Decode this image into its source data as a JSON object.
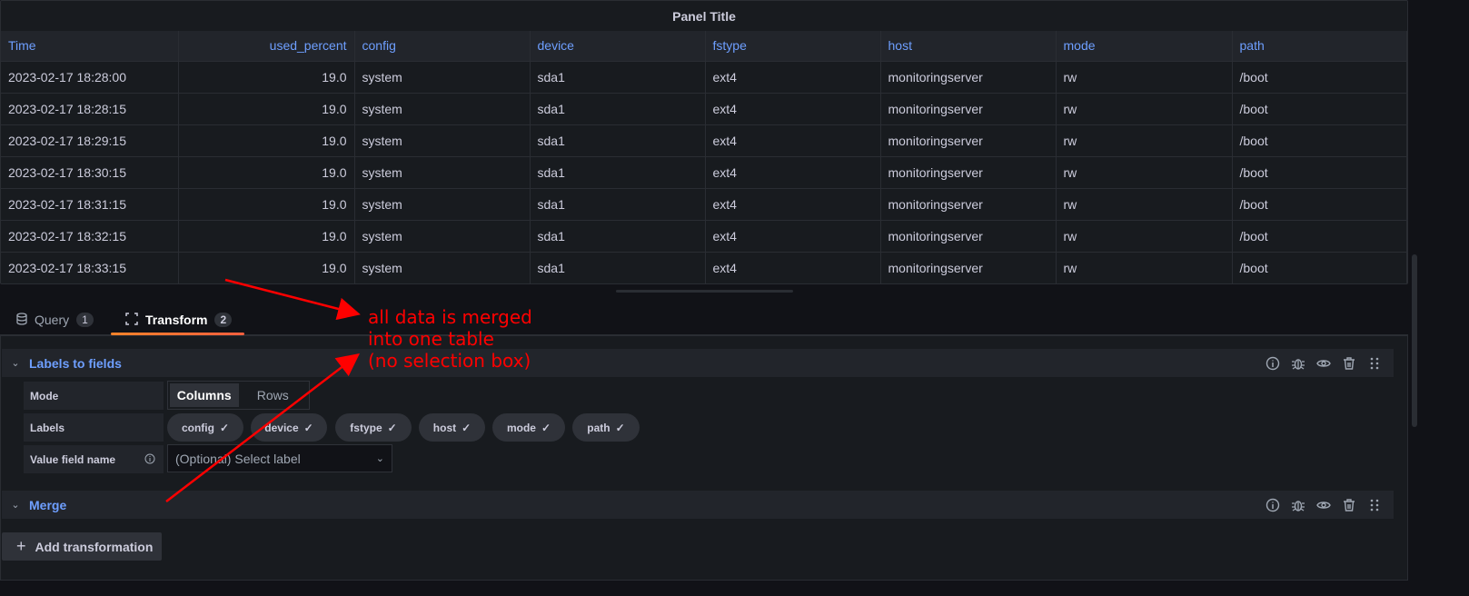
{
  "panel": {
    "title": "Panel Title",
    "columns": [
      "Time",
      "used_percent",
      "config",
      "device",
      "fstype",
      "host",
      "mode",
      "path"
    ],
    "rows": [
      [
        "2023-02-17 18:28:00",
        "19.0",
        "system",
        "sda1",
        "ext4",
        "monitoringserver",
        "rw",
        "/boot"
      ],
      [
        "2023-02-17 18:28:15",
        "19.0",
        "system",
        "sda1",
        "ext4",
        "monitoringserver",
        "rw",
        "/boot"
      ],
      [
        "2023-02-17 18:29:15",
        "19.0",
        "system",
        "sda1",
        "ext4",
        "monitoringserver",
        "rw",
        "/boot"
      ],
      [
        "2023-02-17 18:30:15",
        "19.0",
        "system",
        "sda1",
        "ext4",
        "monitoringserver",
        "rw",
        "/boot"
      ],
      [
        "2023-02-17 18:31:15",
        "19.0",
        "system",
        "sda1",
        "ext4",
        "monitoringserver",
        "rw",
        "/boot"
      ],
      [
        "2023-02-17 18:32:15",
        "19.0",
        "system",
        "sda1",
        "ext4",
        "monitoringserver",
        "rw",
        "/boot"
      ],
      [
        "2023-02-17 18:33:15",
        "19.0",
        "system",
        "sda1",
        "ext4",
        "monitoringserver",
        "rw",
        "/boot"
      ]
    ]
  },
  "tabs": [
    {
      "label": "Query",
      "count": "1"
    },
    {
      "label": "Transform",
      "count": "2"
    }
  ],
  "transformations": [
    {
      "name": "Labels to fields",
      "mode_label": "Mode",
      "mode_options": [
        "Columns",
        "Rows"
      ],
      "mode_selected": "Columns",
      "labels_label": "Labels",
      "labels": [
        "config",
        "device",
        "fstype",
        "host",
        "mode",
        "path"
      ],
      "value_field_label": "Value field name",
      "value_field_placeholder": "(Optional) Select label"
    },
    {
      "name": "Merge"
    }
  ],
  "add_transformation": "Add transformation",
  "annotation": {
    "lines": [
      "all data is merged",
      "into one table",
      "(no selection box)"
    ],
    "color": "#ff0000"
  }
}
